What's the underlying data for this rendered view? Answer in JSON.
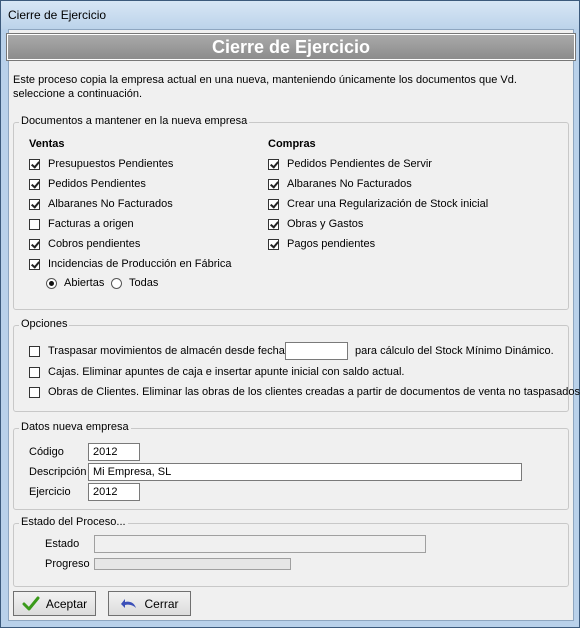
{
  "window": {
    "title": "Cierre de Ejercicio"
  },
  "banner": {
    "title": "Cierre de Ejercicio"
  },
  "intro": "Este proceso copia la empresa actual en una nueva, manteniendo únicamente los documentos que Vd. seleccione a continuación.",
  "documentos": {
    "legend": "Documentos a mantener en la nueva empresa",
    "ventas": {
      "title": "Ventas",
      "items": [
        {
          "label": "Presupuestos Pendientes",
          "checked": true
        },
        {
          "label": "Pedidos Pendientes",
          "checked": true
        },
        {
          "label": "Albaranes No Facturados",
          "checked": true
        },
        {
          "label": "Facturas a origen",
          "checked": false
        },
        {
          "label": "Cobros pendientes",
          "checked": true
        },
        {
          "label": "Incidencias de Producción en Fábrica",
          "checked": true
        }
      ],
      "radios": [
        {
          "label": "Abiertas",
          "selected": true
        },
        {
          "label": "Todas",
          "selected": false
        }
      ]
    },
    "compras": {
      "title": "Compras",
      "items": [
        {
          "label": "Pedidos Pendientes de Servir",
          "checked": true
        },
        {
          "label": "Albaranes No Facturados",
          "checked": true
        },
        {
          "label": "Crear una Regularización de Stock inicial",
          "checked": true
        },
        {
          "label": "Obras y Gastos",
          "checked": true
        },
        {
          "label": "Pagos pendientes",
          "checked": true
        }
      ]
    }
  },
  "opciones": {
    "legend": "Opciones",
    "traspasar": {
      "label": "Traspasar movimientos de almacén desde fecha",
      "checked": false,
      "date_value": "",
      "suffix": "para cálculo del Stock Mínimo Dinámico."
    },
    "cajas": {
      "label": "Cajas. Eliminar apuntes de caja e insertar apunte inicial con saldo actual.",
      "checked": false
    },
    "obras": {
      "label": "Obras de Clientes. Eliminar las obras de los clientes creadas a partir de documentos de venta no taspasados.",
      "checked": false
    }
  },
  "datos": {
    "legend": "Datos nueva empresa",
    "codigo_label": "Código",
    "codigo_value": "2012",
    "descripcion_label": "Descripción",
    "descripcion_value": "Mi Empresa, SL",
    "ejercicio_label": "Ejercicio",
    "ejercicio_value": "2012"
  },
  "estado": {
    "legend": "Estado del Proceso...",
    "estado_label": "Estado",
    "estado_value": "",
    "progreso_label": "Progreso",
    "progreso_fraction": 0
  },
  "buttons": {
    "aceptar": {
      "label": "Aceptar",
      "icon": "checkmark-icon",
      "color": "#3a9a1a"
    },
    "cerrar": {
      "label": "Cerrar",
      "icon": "return-arrow-icon",
      "color": "#3b4fb8"
    }
  }
}
